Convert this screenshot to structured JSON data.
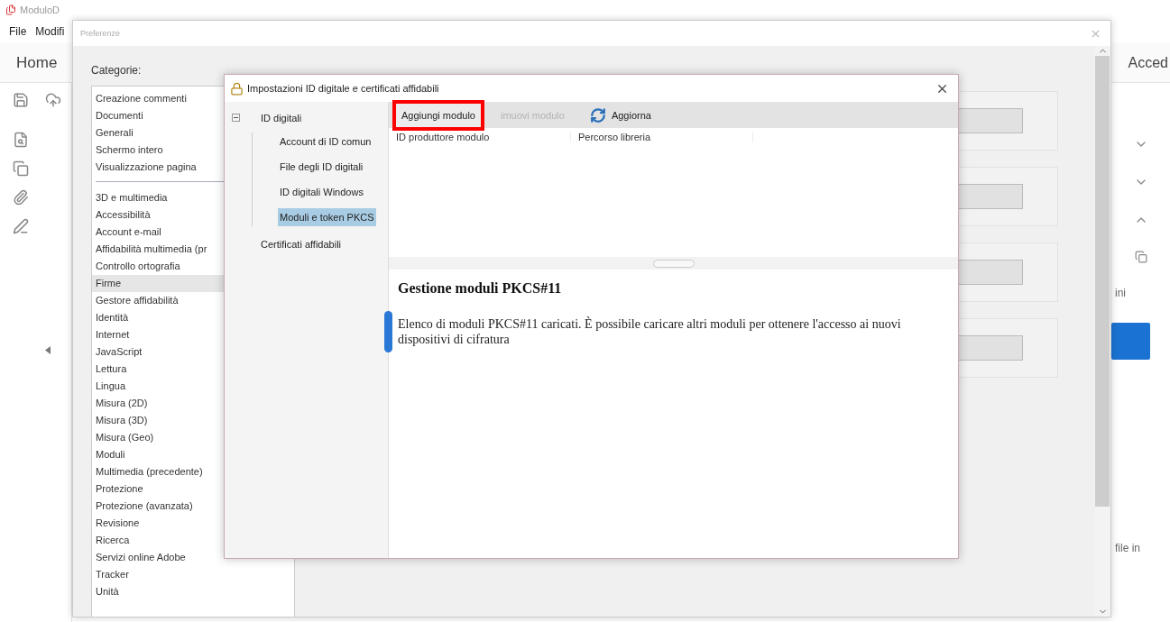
{
  "app": {
    "title": "ModuloD",
    "menu": [
      "File",
      "Modifi"
    ],
    "tab": "Home",
    "right_tab": "Acced",
    "sections": [
      {
        "expanded": false
      },
      {
        "expanded": false
      },
      {
        "expanded": true
      }
    ],
    "right_texts": [
      "ini",
      "file in"
    ]
  },
  "preferences": {
    "title": "Preferenze",
    "categories_label": "Categorie:",
    "category_groups": [
      [
        {
          "label": "Creazione commenti",
          "selected": false
        },
        {
          "label": "Documenti",
          "selected": false
        },
        {
          "label": "Generali",
          "selected": false
        },
        {
          "label": "Schermo intero",
          "selected": false
        },
        {
          "label": "Visualizzazione pagina",
          "selected": false
        }
      ],
      [
        {
          "label": "3D e multimedia",
          "selected": false
        },
        {
          "label": "Accessibilità",
          "selected": false
        },
        {
          "label": "Account e-mail",
          "selected": false
        },
        {
          "label": "Affidabilità multimedia (pr",
          "selected": false
        },
        {
          "label": "Controllo ortografia",
          "selected": false
        },
        {
          "label": "Firme",
          "selected": true
        },
        {
          "label": "Gestore affidabilità",
          "selected": false
        },
        {
          "label": "Identità",
          "selected": false
        },
        {
          "label": "Internet",
          "selected": false
        },
        {
          "label": "JavaScript",
          "selected": false
        },
        {
          "label": "Lettura",
          "selected": false
        },
        {
          "label": "Lingua",
          "selected": false
        },
        {
          "label": "Misura (2D)",
          "selected": false
        },
        {
          "label": "Misura (3D)",
          "selected": false
        },
        {
          "label": "Misura (Geo)",
          "selected": false
        },
        {
          "label": "Moduli",
          "selected": false
        },
        {
          "label": "Multimedia (precedente)",
          "selected": false
        },
        {
          "label": "Protezione",
          "selected": false
        },
        {
          "label": "Protezione (avanzata)",
          "selected": false
        },
        {
          "label": "Revisione",
          "selected": false
        },
        {
          "label": "Ricerca",
          "selected": false
        },
        {
          "label": "Servizi online Adobe",
          "selected": false
        },
        {
          "label": "Tracker",
          "selected": false
        },
        {
          "label": "Unità",
          "selected": false
        }
      ]
    ]
  },
  "dialog": {
    "title": "Impostazioni ID digitale e certificati affidabili",
    "tree": [
      {
        "label": "ID digitali",
        "expanded": true,
        "selected": false,
        "children": [
          {
            "label": "Account di ID comun",
            "selected": false
          },
          {
            "label": "File degli ID digitali",
            "selected": false
          },
          {
            "label": "ID digitali Windows",
            "selected": false
          },
          {
            "label": "Moduli e token PKCS",
            "selected": true
          }
        ]
      },
      {
        "label": "Certificati affidabili",
        "selected": false
      }
    ],
    "toolbar": [
      {
        "kind": "button",
        "label": "Aggiungi modulo",
        "disabled": false,
        "highlighted": true
      },
      {
        "kind": "button",
        "label": "imuovi modulo",
        "disabled": true,
        "highlighted": false
      },
      {
        "kind": "refresh",
        "label": "Aggiorna",
        "disabled": false,
        "highlighted": false
      }
    ],
    "columns": [
      "ID produttore modulo",
      "Percorso libreria"
    ],
    "heading": "Gestione moduli PKCS#11",
    "description": "Elenco di moduli PKCS#11 caricati. È possibile caricare altri moduli per ottenere l'accesso ai nuovi dispositivi di cifratura"
  }
}
